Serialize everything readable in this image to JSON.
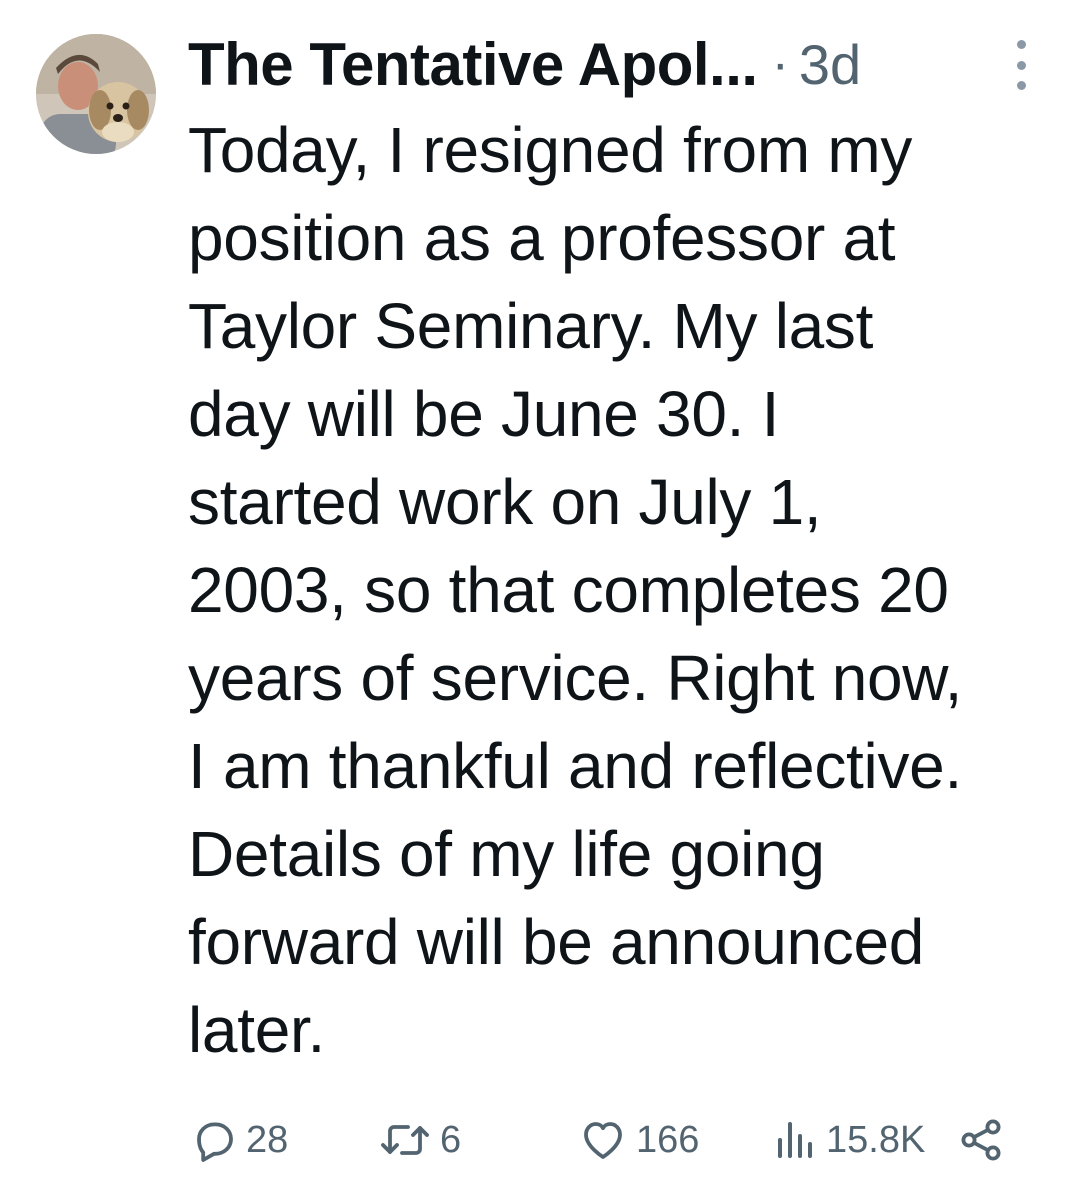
{
  "tweet": {
    "author": {
      "display_name": "The Tentative Apol...",
      "avatar_icon": "user-with-dog-avatar"
    },
    "separator": "·",
    "timestamp": "3d",
    "text_lines": [
      "Today, I resigned from my",
      "position as a professor at",
      "Taylor Seminary. My last",
      "day will be June 30. I",
      "started work on July 1,",
      "2003, so that completes 20",
      "years of service. Right now,",
      "I am thankful and reflective.",
      "Details of my life going",
      "forward will be announced",
      "later."
    ],
    "actions": {
      "reply": {
        "icon": "reply-icon",
        "count": "28"
      },
      "retweet": {
        "icon": "retweet-icon",
        "count": "6"
      },
      "like": {
        "icon": "heart-icon",
        "count": "166"
      },
      "views": {
        "icon": "views-icon",
        "count": "15.8K"
      },
      "share": {
        "icon": "share-icon"
      }
    }
  }
}
